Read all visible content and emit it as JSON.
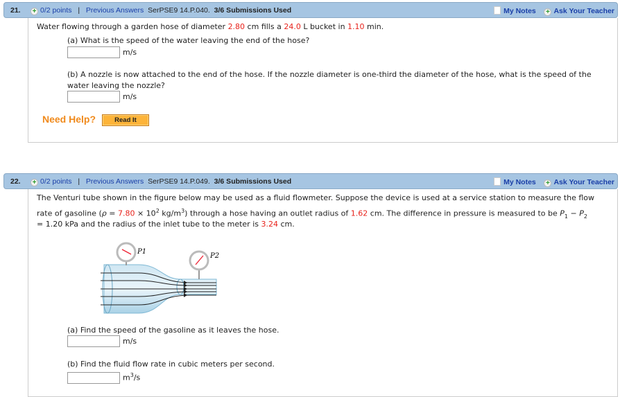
{
  "questions": [
    {
      "number": "21.",
      "points": "0/2 points",
      "separator": "|",
      "prev": "Previous Answers",
      "code": "SerPSE9 14.P.040.",
      "subs": "3/6 Submissions Used",
      "my_notes": "My Notes",
      "ask": "Ask Your Teacher",
      "text": [
        "Water flowing through a garden hose of diameter ",
        "2.80",
        " cm fills a ",
        "24.0",
        " L bucket in ",
        "1.10",
        " min."
      ],
      "a_label": "(a) What is the speed of the water leaving the end of the hose?",
      "a_unit": "m/s",
      "b_label1": "(b) A nozzle is now attached to the end of the hose. If the nozzle diameter is one-third the diameter of the hose, what is the speed of the",
      "b_label2": "water leaving the nozzle?",
      "b_unit": "m/s",
      "need_help": "Need Help?",
      "read_it": "Read It"
    },
    {
      "number": "22.",
      "points": "0/2 points",
      "separator": "|",
      "prev": "Previous Answers",
      "code": "SerPSE9 14.P.049.",
      "subs": "3/6 Submissions Used",
      "my_notes": "My Notes",
      "ask": "Ask Your Teacher",
      "line1": "The Venturi tube shown in the figure below may be used as a fluid flowmeter. Suppose the device is used at a service station to measure the flow",
      "line2": [
        "rate of gasoline (",
        "ρ",
        " = ",
        "7.80",
        " × 10",
        "2",
        " kg/m",
        "3",
        ") through a hose having an outlet radius of ",
        "1.62",
        " cm. The difference in pressure is measured to be ",
        "P",
        "1",
        " − ",
        "P",
        "2"
      ],
      "line3": [
        "= 1.20 kPa and the radius of the inlet tube to the meter is ",
        "3.24",
        " cm."
      ],
      "figure": {
        "p1": "P1",
        "p2": "P2"
      },
      "a_label": "(a) Find the speed of the gasoline as it leaves the hose.",
      "a_unit": "m/s",
      "b_label": "(b) Find the fluid flow rate in cubic meters per second.",
      "b_unit": "m",
      "b_unit_sup": "3",
      "b_unit_tail": "/s"
    }
  ]
}
